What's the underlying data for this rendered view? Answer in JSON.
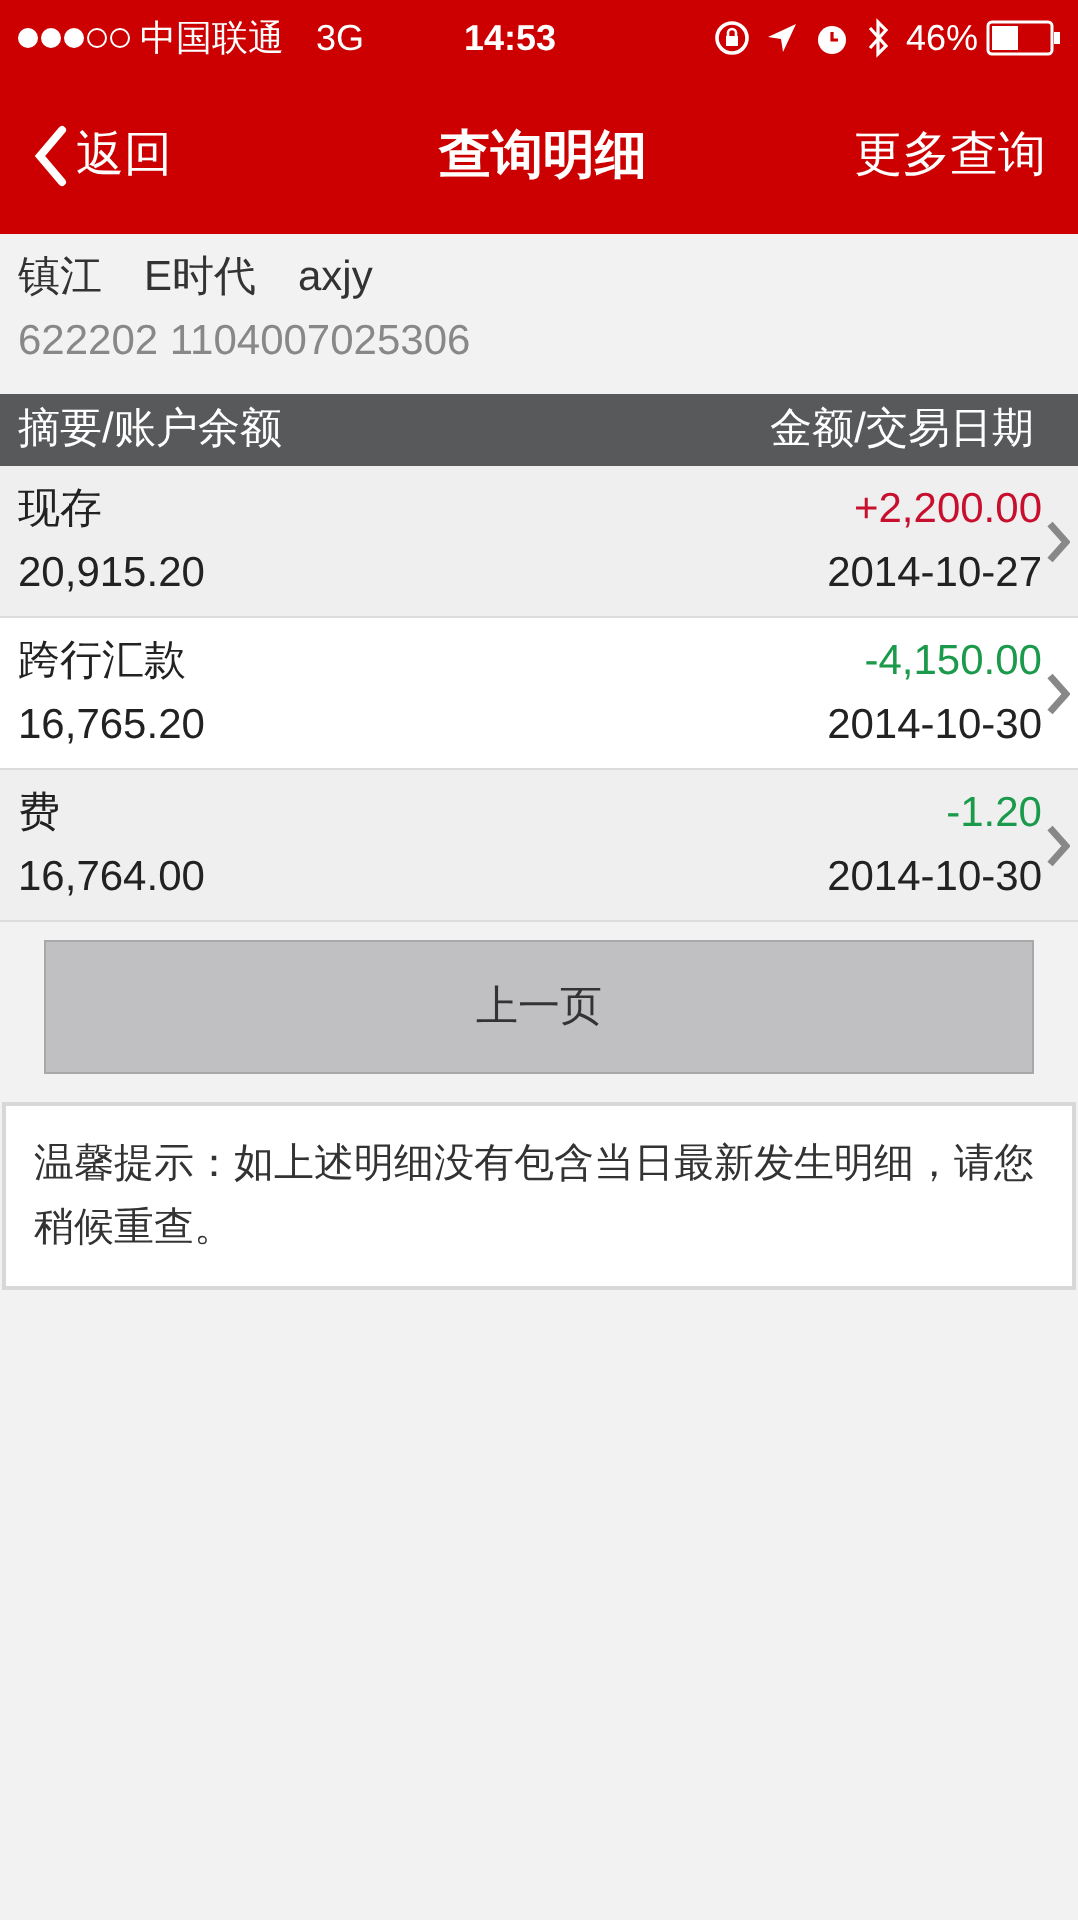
{
  "status_bar": {
    "carrier": "中国联通",
    "network": "3G",
    "time": "14:53",
    "battery": "46%"
  },
  "nav": {
    "back": "返回",
    "title": "查询明细",
    "action": "更多查询"
  },
  "account": {
    "name": "镇江　E时代　axjy",
    "number": "622202 1104007025306"
  },
  "table": {
    "columns": [
      "摘要/账户余额",
      "金额/交易日期"
    ],
    "rows": [
      {
        "summary": "现存",
        "balance": "20,915.20",
        "amount": "+2,200.00",
        "color": "#c8102e",
        "date": "2014-10-27"
      },
      {
        "summary": "跨行汇款",
        "balance": "16,765.20",
        "amount": "-4,150.00",
        "color": "#1a9a4a",
        "date": "2014-10-30"
      },
      {
        "summary": "费",
        "balance": "16,764.00",
        "amount": "-1.20",
        "color": "#1a9a4a",
        "date": "2014-10-30"
      }
    ]
  },
  "prev_button": "上一页",
  "notice": "温馨提示：如上述明细没有包含当日最新发生明细，请您稍候重查。"
}
